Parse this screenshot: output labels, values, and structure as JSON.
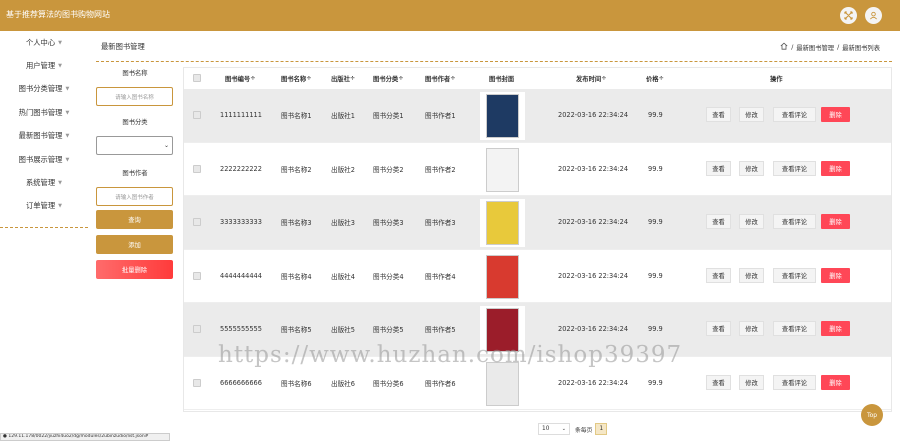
{
  "app": {
    "title": "基于推荐算法的图书购物网站"
  },
  "sidebar": {
    "items": [
      {
        "label": "个人中心"
      },
      {
        "label": "用户管理"
      },
      {
        "label": "图书分类管理"
      },
      {
        "label": "热门图书管理"
      },
      {
        "label": "最新图书管理"
      },
      {
        "label": "图书展示管理"
      },
      {
        "label": "系统管理"
      },
      {
        "label": "订单管理"
      }
    ]
  },
  "page": {
    "title": "最新图书管理"
  },
  "breadcrumb": {
    "items": [
      "最新图书管理",
      "最新图书列表"
    ]
  },
  "filter": {
    "name_label": "图书名称",
    "name_placeholder": "请输入图书名称",
    "category_label": "图书分类",
    "category_value": "",
    "author_label": "图书作者",
    "author_placeholder": "请输入图书作者",
    "search_button": "查询",
    "add_button": "添加",
    "batch_delete_button": "批量删除"
  },
  "table": {
    "columns": [
      "图书编号",
      "图书名称",
      "出版社",
      "图书分类",
      "图书作者",
      "图书封面",
      "发布时间",
      "价格",
      "操作"
    ],
    "sort_marker": "÷",
    "rows": [
      {
        "id": "1111111111",
        "name": "图书名称1",
        "publisher": "出版社1",
        "category": "图书分类1",
        "author": "图书作者1",
        "time": "2022-03-16 22:34:24",
        "price": "99.9",
        "cover_color": "#1e3a63"
      },
      {
        "id": "2222222222",
        "name": "图书名称2",
        "publisher": "出版社2",
        "category": "图书分类2",
        "author": "图书作者2",
        "time": "2022-03-16 22:34:24",
        "price": "99.9",
        "cover_color": "#f3f3f3"
      },
      {
        "id": "3333333333",
        "name": "图书名称3",
        "publisher": "出版社3",
        "category": "图书分类3",
        "author": "图书作者3",
        "time": "2022-03-16 22:34:24",
        "price": "99.9",
        "cover_color": "#e8c93b"
      },
      {
        "id": "4444444444",
        "name": "图书名称4",
        "publisher": "出版社4",
        "category": "图书分类4",
        "author": "图书作者4",
        "time": "2022-03-16 22:34:24",
        "price": "99.9",
        "cover_color": "#d83a2f"
      },
      {
        "id": "5555555555",
        "name": "图书名称5",
        "publisher": "出版社5",
        "category": "图书分类5",
        "author": "图书作者5",
        "time": "2022-03-16 22:34:24",
        "price": "99.9",
        "cover_color": "#9b1d2a"
      },
      {
        "id": "6666666666",
        "name": "图书名称6",
        "publisher": "出版社6",
        "category": "图书分类6",
        "author": "图书作者6",
        "time": "2022-03-16 22:34:24",
        "price": "99.9",
        "cover_color": "#eaeaea"
      }
    ],
    "actions": {
      "view": "查看",
      "edit": "修改",
      "view_comments": "查看评论",
      "delete": "删除"
    }
  },
  "pager": {
    "page_size": "10",
    "prev": "条每页",
    "current": "1"
  },
  "watermark": "https://www.huzhan.com/ishop39397",
  "top_button": "Top",
  "status_url": "● 129.11.178/0022/jiuzhi4uo2/dg/modules/2ubinzudio/list.json#"
}
